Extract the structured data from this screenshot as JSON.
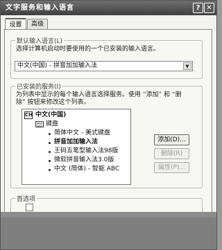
{
  "window": {
    "title": "文字服务和输入语言",
    "help_glyph": "?",
    "close_glyph": "✕"
  },
  "tabs": [
    {
      "label": "设置",
      "active": true
    },
    {
      "label": "高级",
      "active": false
    }
  ],
  "default_language": {
    "group_label": "默认输入语言(L)",
    "description": "选择计算机启动时要使用的一个已安装的输入语言。",
    "selected": "中文(中国) - 拼音加加输入法"
  },
  "installed_services": {
    "group_label": "已安装的服务(I)",
    "description_line1": "为列表中显示的每个输入语言选择服务。使用 “添加” 和 “删",
    "description_line2": "除” 按钮来修改这个列表。",
    "tree": {
      "language": "中文(中国)",
      "language_icon": "CH",
      "category": "键盘",
      "items": [
        {
          "label": "简体中文 - 美式键盘",
          "selected": false
        },
        {
          "label": "拼音加加输入法",
          "selected": true
        },
        {
          "label": "王码五笔型输入法98版",
          "selected": false
        },
        {
          "label": "微软拼音输入法3.0版",
          "selected": false
        },
        {
          "label": "中文 (简体) - 智能 ABC",
          "selected": false
        }
      ]
    },
    "buttons": {
      "add": "添加(D)...",
      "remove": "删除(R)",
      "properties": "属性(P)..."
    }
  },
  "preferences": {
    "group_label": "首选项"
  },
  "colors": {
    "titlebar": "#4f4f4f",
    "dialog_bg": "#f2f2ee"
  }
}
